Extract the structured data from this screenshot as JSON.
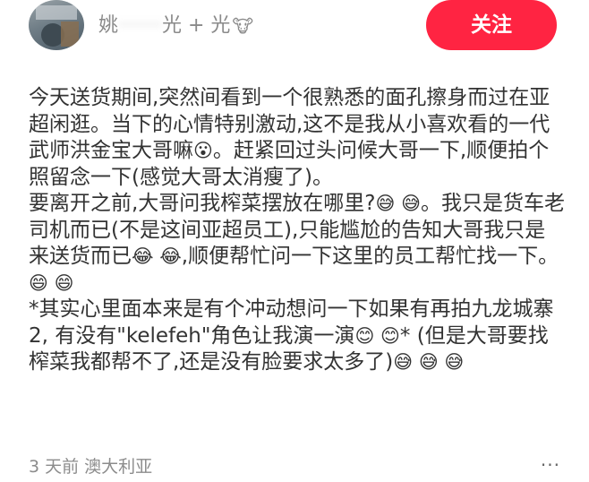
{
  "header": {
    "username_visible_start": "姚",
    "username_blurred": "·······",
    "username_visible_end": "光 +  光",
    "follow_label": "关注",
    "brand_color": "#ff2442"
  },
  "post": {
    "paragraphs": [
      {
        "text": "今天送货期间,突然间看到一个很熟悉的面孔擦身而过在亚超闲逛。当下的心情特别激动,这不是我从小喜欢看的一代武师洪金宝大哥嘛",
        "emoji": "😮",
        "after": "。赶紧回过头问候大哥一下,顺便拍个照留念一下(感觉大哥太消瘦了)。"
      },
      {
        "text": "要离开之前,大哥问我榨菜摆放在哪里?",
        "emoji": "😅 😅",
        "after": "。我只是货车老司机而已(不是这间亚超员工),只能尴尬的告知大哥我只是来送货而已"
      },
      {
        "text": "",
        "emoji": "😂 😂",
        "after": ",顺便帮忙问一下这里的员工帮忙找一下。"
      },
      {
        "text": "",
        "emoji": "😄 😄",
        "after": ""
      },
      {
        "text": "*其实心里面本来是有个冲动想问一下如果有再拍九龙城寨2, 有没有\"kelefeh\"角色让我演一演",
        "emoji": "😊 😊",
        "after": "* (但是大哥要找榨菜我都帮不了,还是没有脸要求太多了)"
      },
      {
        "text": "",
        "emoji": "😅 😅 😅",
        "after": ""
      }
    ]
  },
  "footer": {
    "meta": "3 天前 澳大利亚",
    "more_icon": "···"
  }
}
